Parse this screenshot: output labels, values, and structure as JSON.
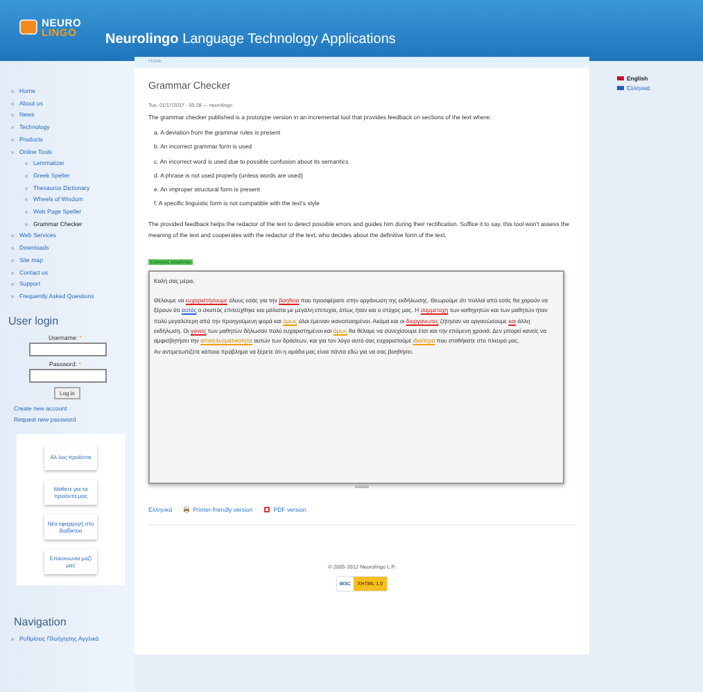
{
  "header": {
    "logo": {
      "top": "NEURO",
      "bottom": "LINGO"
    },
    "title_bold": "Neurolingo",
    "title_rest": "Language Technology Applications"
  },
  "breadcrumb": "Home",
  "menu": [
    {
      "label": "Home",
      "selected": false
    },
    {
      "label": "About us",
      "selected": false
    },
    {
      "label": "News",
      "selected": false
    },
    {
      "label": "Technology",
      "selected": false
    },
    {
      "label": "Products",
      "selected": false
    },
    {
      "label": "Online Tools",
      "selected": false,
      "children": [
        {
          "label": "Lemmatizer",
          "selected": false
        },
        {
          "label": "Greek Speller",
          "selected": false
        },
        {
          "label": "Thesaurus Dictionary",
          "selected": false
        },
        {
          "label": "Wheels of Wisdom",
          "selected": false
        },
        {
          "label": "Web Page Speller",
          "selected": false
        },
        {
          "label": "Grammar Checker",
          "selected": true
        }
      ]
    },
    {
      "label": "Web Services",
      "selected": false
    },
    {
      "label": "Downloads",
      "selected": false
    },
    {
      "label": "Site map",
      "selected": false
    },
    {
      "label": "Contact us",
      "selected": false
    },
    {
      "label": "Support",
      "selected": false
    },
    {
      "label": "Frequently Asked Questions",
      "selected": false
    }
  ],
  "login": {
    "title": "User login",
    "username_label": "Username:",
    "password_label": "Password:",
    "required": "*",
    "button": "Log in",
    "links": [
      "Create new account",
      "Request new password"
    ]
  },
  "banners": [
    "Αλ λος προϊόντα",
    "Μάθετε για τα προϊόντα μας",
    "Νέα εφαρμογή στο διαδίκτυο",
    "Επικοινωνία μαζί μας"
  ],
  "navigation": {
    "title": "Navigation",
    "items": [
      "Ρυθμίσεις Πλοήγησης Αγγλικά"
    ]
  },
  "article": {
    "title": "Grammar Checker",
    "meta": "Tue, 01/17/2017 - 00:28 — neurolingo",
    "intro": "The grammar checker published is a prototype version in an incremental tool that provides feedback on sections of the text where:",
    "list": [
      {
        "marker": "a.",
        "text": "A deviation from the grammar rules is present"
      },
      {
        "marker": "b.",
        "text": "An incorrect grammar form is used"
      },
      {
        "marker": "c.",
        "text": "An incorrect word is used due to possible confusion about its semantics"
      },
      {
        "marker": "d.",
        "text": "A phrase is not used properly (unless words are used)"
      },
      {
        "marker": "e.",
        "text": "An improper structural form is present"
      },
      {
        "marker": "f.",
        "text": "A specific linguistic form is not compatible with the text's style"
      }
    ],
    "outro": "The provided feedback helps the redactor of the text to detect possible errors and guides him during their rectification. Suffice it to say, this tool won't assess the meaning of the text and cooperates with the redactor of the text, who decides about the definitive form of the text.",
    "check_button": "Έλεγχος κειμένου",
    "text": [
      [
        {
          "text": "Καλή σας μέρα,",
          "kind": "plain"
        }
      ],
      [
        {
          "text": "Θέλουμε να ",
          "kind": "plain"
        },
        {
          "text": "ευχαριστήσουμε",
          "kind": "error"
        },
        {
          "text": " όλους εσάς για την ",
          "kind": "plain"
        },
        {
          "text": "βοηθεια",
          "kind": "error"
        },
        {
          "text": " που προσφέρατε στην οργάνωση της εκδήλωσης. Θεωρούμε ότι πολλοί από εσάς θα χαρούν να ξέρουν ότι ",
          "kind": "plain"
        },
        {
          "text": "αυτός",
          "kind": "suggestion"
        },
        {
          "text": " ο σκοπός επιτεύχθηκε και μάλιστα με μεγάλη επιτυχία, όπως ήταν και ο στόχος μας. Η ",
          "kind": "plain"
        },
        {
          "text": "συμμετοχη",
          "kind": "error"
        },
        {
          "text": " των καθηγητών και των μαθητών ήταν πολύ μεγαλύτερη από την προηγούμενη φορά και ",
          "kind": "plain"
        },
        {
          "text": "όμως",
          "kind": "style"
        },
        {
          "text": " όλοι έμειναν ικανοποιημένοι. Ακόμα και οι ",
          "kind": "plain"
        },
        {
          "text": "διοργανωτες",
          "kind": "error"
        },
        {
          "text": " ζήτησαν να οργανώσουμε ",
          "kind": "plain"
        },
        {
          "text": "και",
          "kind": "error"
        },
        {
          "text": " άλλη εκδήλωση. Οι ",
          "kind": "plain"
        },
        {
          "text": "γονεις",
          "kind": "error"
        },
        {
          "text": " των μαθητών δήλωσαν πολύ ευχαριστημένοι και ",
          "kind": "plain"
        },
        {
          "text": "όμως",
          "kind": "style"
        },
        {
          "text": " θα θέλαμε να συνεχίσουμε έτσι και την επόμενη χρονιά. Δεν μπορεί κανείς να αμφισβητήσει την ",
          "kind": "plain"
        },
        {
          "text": "αποτελεσματικοτητα",
          "kind": "style"
        },
        {
          "text": " αυτών των δράσεων, και για τον λόγο αυτό σας ευχαριστούμε ",
          "kind": "plain"
        },
        {
          "text": "ιδιαίτερα",
          "kind": "style"
        },
        {
          "text": " που σταθήκατε στο πλευρό μας.",
          "kind": "plain"
        }
      ],
      [
        {
          "text": "Αν αντιμετωπίζετε κάποιο πρόβλημα να ξέρετε ότι η ομάδα μας είναι πάντα εδώ για να σας βοηθήσει.",
          "kind": "plain"
        }
      ]
    ],
    "links": [
      {
        "text": "Ελληνικά",
        "kind": "plain"
      },
      {
        "text": "Printer-friendly version",
        "kind": "printer"
      },
      {
        "text": "PDF version",
        "kind": "pdf"
      }
    ]
  },
  "footer": {
    "copyright": "© 2005-2012 Neurolingo L.P.",
    "badge_left": "W3C",
    "badge_right": "XHTML 1.0"
  },
  "languages": [
    {
      "label": "English",
      "selected": true,
      "color": "#c8102e"
    },
    {
      "label": "Ελληνικά",
      "selected": false,
      "color": "#1f5fbf"
    }
  ]
}
